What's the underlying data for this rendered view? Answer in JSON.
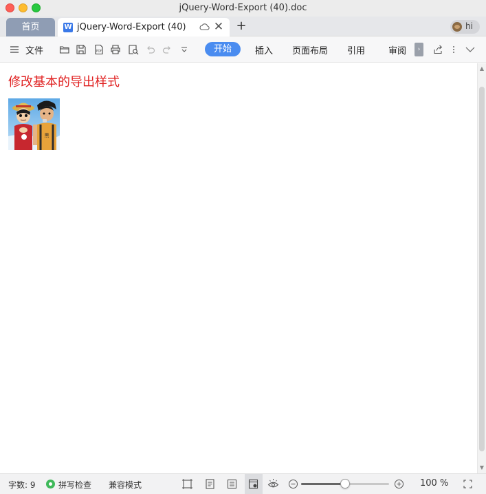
{
  "window": {
    "title": "jQuery-Word-Export (40).doc"
  },
  "tabs": {
    "home_label": "首页",
    "doc_label": "jQuery-Word-Export (40)",
    "user_name": "hi"
  },
  "toolbar": {
    "menu_label": "文件",
    "ribbon_tabs": [
      "开始",
      "插入",
      "页面布局",
      "引用",
      "审阅"
    ],
    "active_tab": "开始",
    "icons": [
      "menu-icon",
      "open-folder-icon",
      "save-icon",
      "export-pdf-icon",
      "print-icon",
      "print-preview-icon",
      "undo-icon",
      "redo-icon",
      "customize-dropdown-icon",
      "share-icon",
      "more-vertical-icon",
      "collapse-chevron-icon"
    ]
  },
  "document": {
    "heading": "修改基本的导出样式",
    "heading_color": "#e02020",
    "image": "cartoon-characters-image"
  },
  "statusbar": {
    "word_count": "字数: 9",
    "spell_check": "拼写检查",
    "compat_mode": "兼容模式",
    "zoom_label": "100 %",
    "zoom_fraction": 0.5
  },
  "colors": {
    "accent": "#4a8cf0",
    "home_tab": "#8f9db4",
    "spell_ok": "#3fb95a"
  }
}
